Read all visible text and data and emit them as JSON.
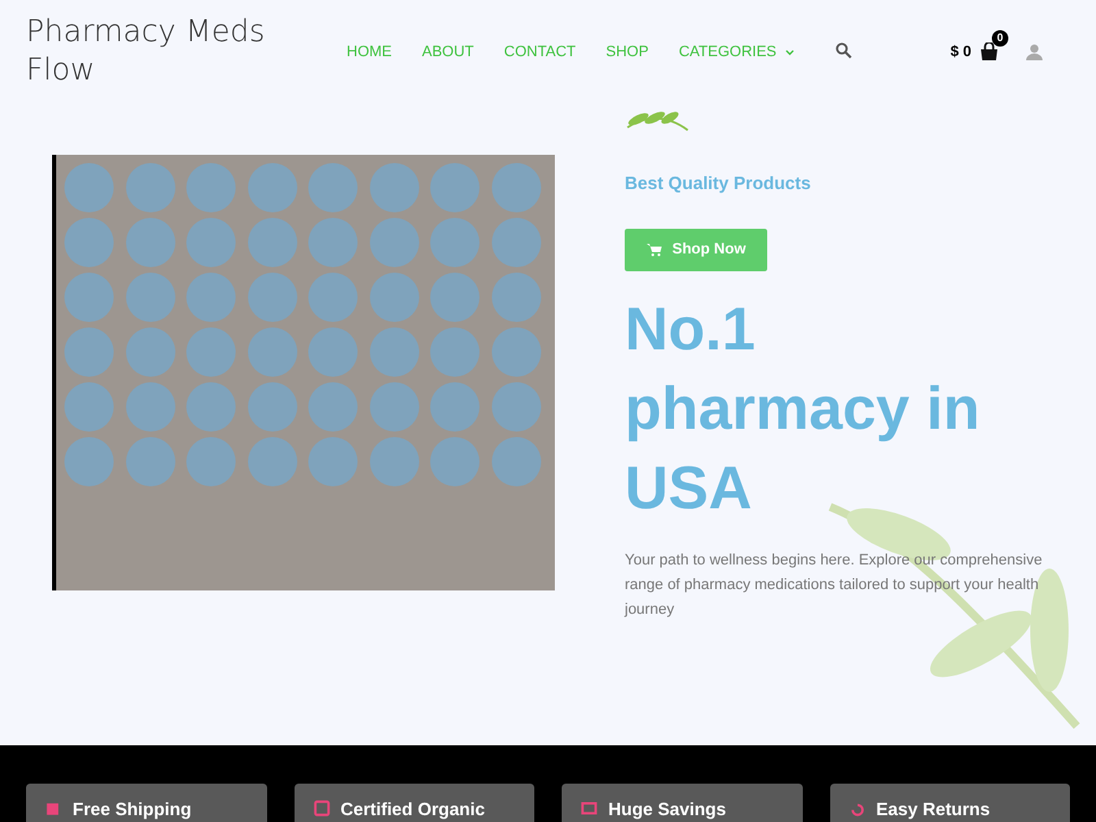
{
  "site_title": "Pharmacy Meds Flow",
  "nav": [
    {
      "label": "HOME",
      "kind": "link"
    },
    {
      "label": "ABOUT",
      "kind": "link"
    },
    {
      "label": "CONTACT",
      "kind": "link"
    },
    {
      "label": "SHOP",
      "kind": "link"
    },
    {
      "label": "CATEGORIES",
      "kind": "dropdown"
    }
  ],
  "cart": {
    "total": "$ 0",
    "count": "0"
  },
  "hero": {
    "subtitle": "Best Quality Products",
    "button": "Shop Now",
    "heading": "No.1 pharmacy in USA",
    "text": "Your path to wellness begins here. Explore our comprehensive range of pharmacy medications tailored to support your health journey"
  },
  "features": [
    {
      "title": "Free Shipping"
    },
    {
      "title": "Certified Organic"
    },
    {
      "title": "Huge Savings"
    },
    {
      "title": "Easy Returns"
    }
  ]
}
